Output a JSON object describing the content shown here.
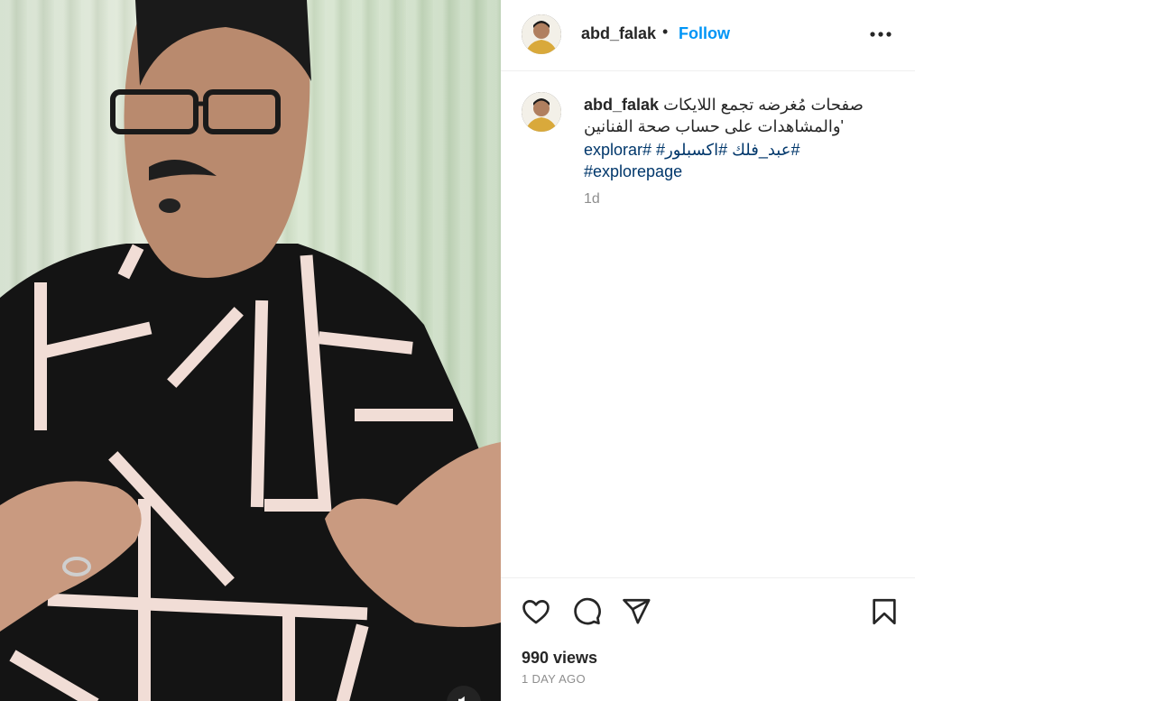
{
  "post": {
    "username": "abd_falak",
    "separator": "•",
    "follow_label": "Follow",
    "more_icon": "more-horizontal-icon",
    "caption": {
      "username": "abd_falak",
      "text": "صفحات مُغرضه تجمع اللايكات والمشاهدات على حساب صحة الفنانين'",
      "hashtags_line1": "explorar# #عبد_فلك #اكسبلور#",
      "hashtags_line2": "#explorepage",
      "time": "1d"
    },
    "actions": {
      "like_icon": "heart-icon",
      "comment_icon": "comment-icon",
      "share_icon": "send-icon",
      "save_icon": "bookmark-icon"
    },
    "views": "990 views",
    "date": "1 DAY AGO"
  },
  "media": {
    "mute_icon": "speaker-icon"
  },
  "colors": {
    "follow": "#0095f6",
    "hashtag": "#00376b",
    "muted_text": "#8e8e8e"
  }
}
